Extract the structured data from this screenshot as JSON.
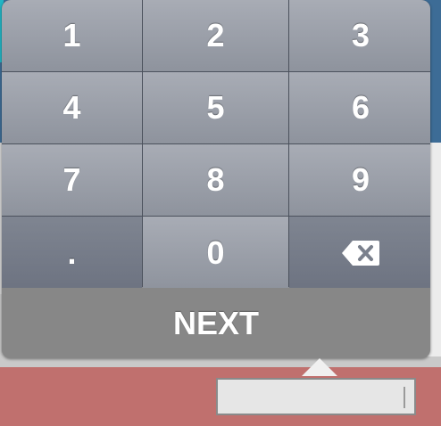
{
  "keypad": {
    "keys": [
      "1",
      "2",
      "3",
      "4",
      "5",
      "6",
      "7",
      "8",
      "9",
      ".",
      "0"
    ],
    "backspace_icon": "backspace-icon"
  },
  "next_button": {
    "label": "NEXT"
  },
  "input": {
    "value": ""
  },
  "colors": {
    "key_top": "#a8acb5",
    "key_bottom": "#8e939d",
    "next_bg": "#878787",
    "app_header": "#3d6c96",
    "app_footer": "#c0706e"
  }
}
